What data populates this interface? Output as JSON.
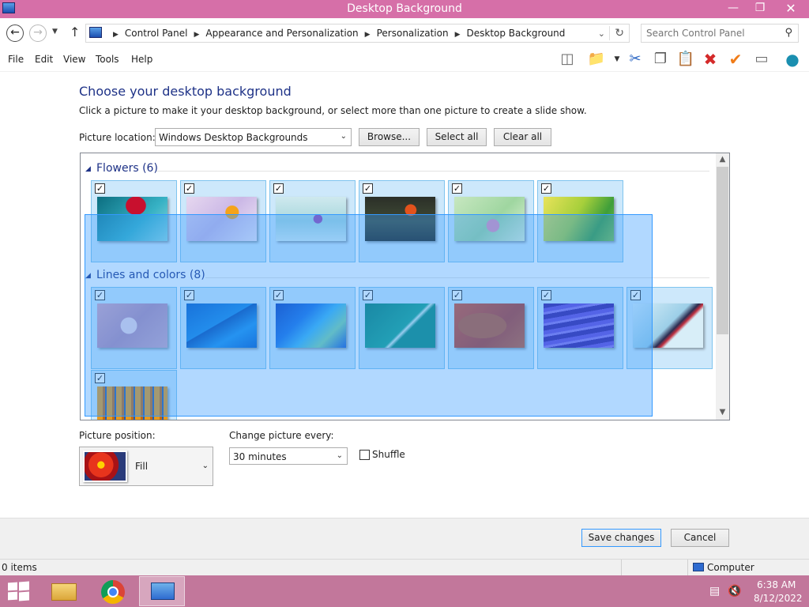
{
  "window": {
    "title": "Desktop Background"
  },
  "address": {
    "crumbs": [
      "Control Panel",
      "Appearance and Personalization",
      "Personalization",
      "Desktop Background"
    ]
  },
  "search": {
    "placeholder": "Search Control Panel"
  },
  "menu": [
    "File",
    "Edit",
    "View",
    "Tools",
    "Help"
  ],
  "page": {
    "heading": "Choose your desktop background",
    "subtext": "Click a picture to make it your desktop background, or select more than one picture to create a slide show.",
    "location_label": "Picture location:",
    "location_value": "Windows Desktop Backgrounds",
    "browse": "Browse...",
    "select_all": "Select all",
    "clear_all": "Clear all"
  },
  "groups": [
    {
      "title": "Flowers (6)"
    },
    {
      "title": "Lines and colors (8)"
    }
  ],
  "bottom": {
    "position_label": "Picture position:",
    "position_value": "Fill",
    "change_label": "Change picture every:",
    "change_value": "30 minutes",
    "shuffle": "Shuffle",
    "save": "Save changes",
    "cancel": "Cancel"
  },
  "status": {
    "items": "0 items",
    "computer": "Computer"
  },
  "tray": {
    "time": "6:38 AM",
    "date": "8/12/2022"
  },
  "colors": {
    "title_bar": "#d66fa8",
    "taskbar": "#c2779b",
    "selection": "#3399ff",
    "heading": "#1e3287"
  }
}
